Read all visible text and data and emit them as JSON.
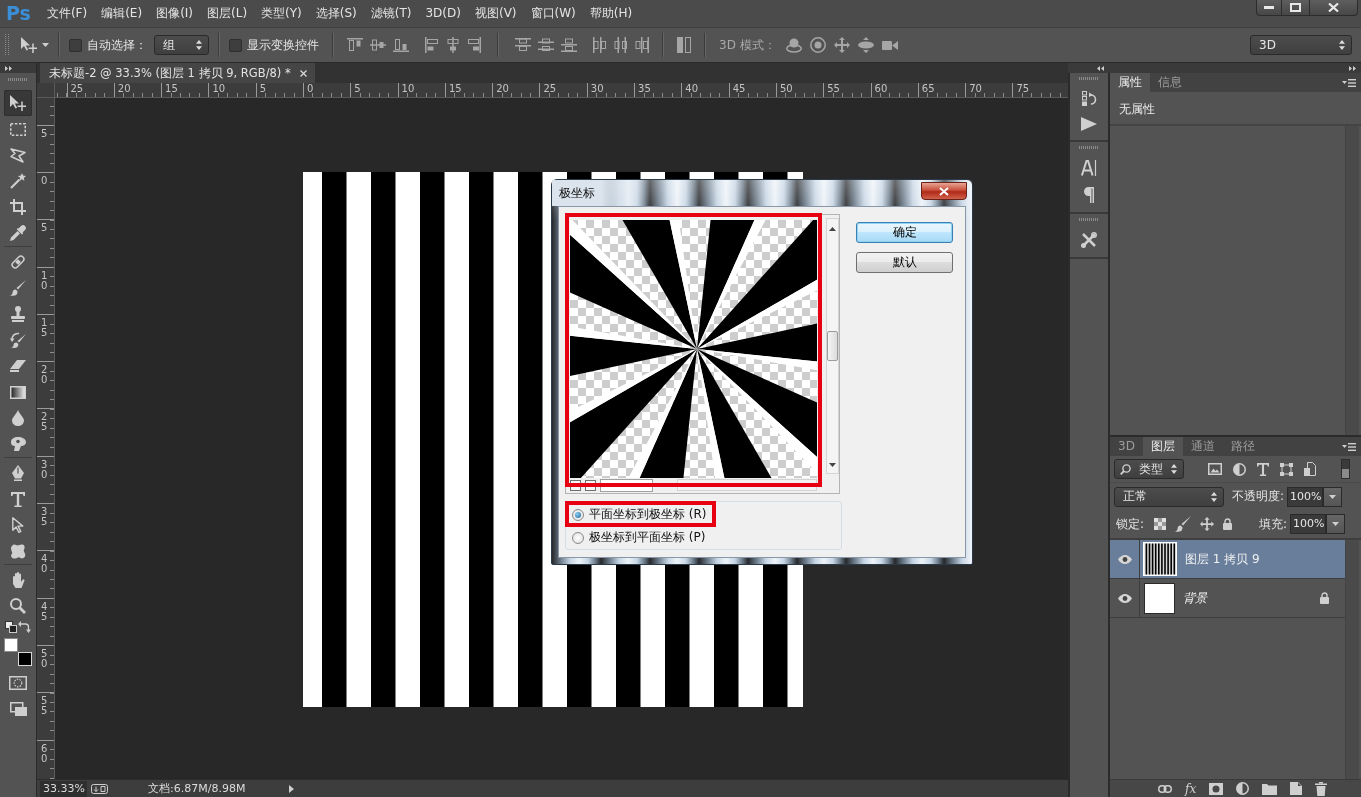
{
  "menu_bar": {
    "logo": "Ps",
    "items": [
      "文件(F)",
      "编辑(E)",
      "图像(I)",
      "图层(L)",
      "类型(Y)",
      "选择(S)",
      "滤镜(T)",
      "3D(D)",
      "视图(V)",
      "窗口(W)",
      "帮助(H)"
    ]
  },
  "options_bar": {
    "auto_select": {
      "label": "自动选择：",
      "checked": false
    },
    "auto_select_target": {
      "value": "组"
    },
    "show_transform_controls": {
      "label": "显示变换控件",
      "checked": false
    },
    "mode_3d_label": "3D 模式：",
    "workspace": {
      "value": "3D"
    }
  },
  "toolbar": {
    "tools": [
      {
        "kind": "move",
        "selected": true
      },
      {
        "kind": "marquee",
        "selected": false
      },
      {
        "kind": "lasso",
        "selected": false
      },
      {
        "kind": "wand",
        "selected": false
      },
      {
        "kind": "crop",
        "selected": false
      },
      {
        "kind": "eyedropper",
        "selected": false
      },
      {
        "kind": "healing",
        "selected": false
      },
      {
        "kind": "brush",
        "selected": false
      },
      {
        "kind": "stamp",
        "selected": false
      },
      {
        "kind": "historybrush",
        "selected": false
      },
      {
        "kind": "eraser",
        "selected": false
      },
      {
        "kind": "gradient",
        "selected": false
      },
      {
        "kind": "blur",
        "selected": false
      },
      {
        "kind": "dodge",
        "selected": false
      },
      {
        "kind": "pen",
        "selected": false
      },
      {
        "kind": "type",
        "selected": false
      },
      {
        "kind": "pathselect",
        "selected": false
      },
      {
        "kind": "shape",
        "selected": false
      },
      {
        "kind": "hand",
        "selected": false
      },
      {
        "kind": "zoom",
        "selected": false
      }
    ],
    "foreground": {
      "color": "#ffffff"
    },
    "background": {
      "color": "#000000"
    }
  },
  "document": {
    "tab_title": "未标题-2 @ 33.3% (图层 1 拷贝 9, RGB/8) *",
    "ruler_horizontal": [
      "25",
      "20",
      "15",
      "10",
      "5",
      "0",
      "5",
      "10",
      "15",
      "20",
      "25",
      "30",
      "35",
      "40",
      "45",
      "50",
      "55",
      "60",
      "65",
      "70",
      "75"
    ],
    "ruler_vertical": [
      "5",
      "0",
      "5",
      "10",
      "15",
      "20",
      "25",
      "30",
      "35",
      "40",
      "45",
      "50",
      "55",
      "60"
    ]
  },
  "dialog": {
    "title": "极坐标",
    "preview": {
      "highlighted": true
    },
    "buttons": [
      {
        "label": "确定",
        "default": true
      },
      {
        "label": "默认",
        "default": false
      }
    ],
    "options": [
      {
        "label": "平面坐标到极坐标 (R)",
        "selected": true,
        "highlighted": true
      },
      {
        "label": "极坐标到平面坐标 (P)",
        "selected": false,
        "highlighted": false
      }
    ]
  },
  "properties_panel": {
    "tabs": [
      {
        "label": "属性",
        "selected": true
      },
      {
        "label": "信息",
        "selected": false
      }
    ],
    "message": "无属性"
  },
  "layers_panel": {
    "tabs": [
      {
        "label": "3D",
        "selected": false
      },
      {
        "label": "图层",
        "selected": true
      },
      {
        "label": "通道",
        "selected": false
      },
      {
        "label": "路径",
        "selected": false
      }
    ],
    "filter": {
      "value": "类型"
    },
    "blend_mode": {
      "value": "正常"
    },
    "opacity": {
      "label": "不透明度:",
      "value": "100%"
    },
    "lock_label": "锁定:",
    "fill": {
      "label": "填充:",
      "value": "100%"
    },
    "layers": [
      {
        "name": "图层 1 拷贝 9",
        "kind": "stripes",
        "selected": true,
        "visible": true,
        "locked": false
      },
      {
        "name": "背景",
        "kind": "background",
        "selected": false,
        "visible": true,
        "locked": true
      }
    ],
    "effects_button": "fx"
  },
  "status_bar": {
    "zoom": "33.33%",
    "document_size": "文档:6.87M/8.98M"
  }
}
